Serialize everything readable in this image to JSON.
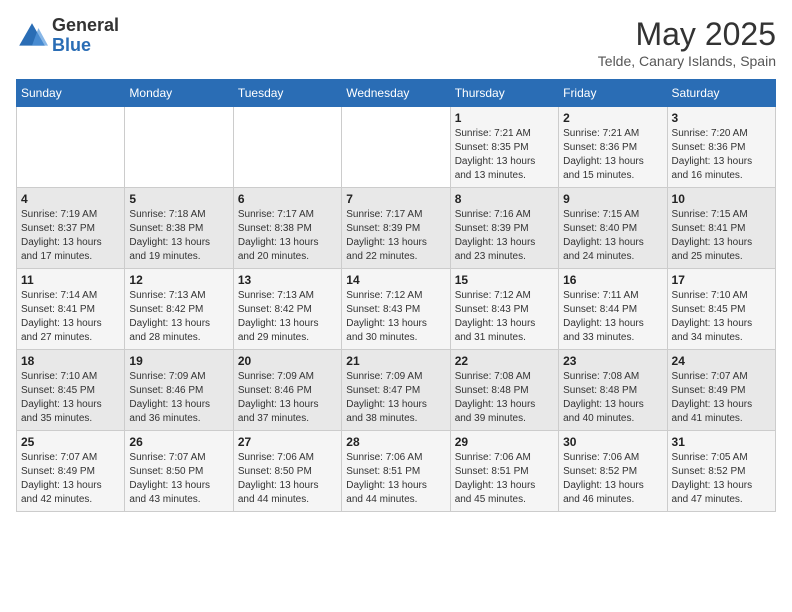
{
  "header": {
    "logo_general": "General",
    "logo_blue": "Blue",
    "month_year": "May 2025",
    "location": "Telde, Canary Islands, Spain"
  },
  "days_of_week": [
    "Sunday",
    "Monday",
    "Tuesday",
    "Wednesday",
    "Thursday",
    "Friday",
    "Saturday"
  ],
  "weeks": [
    [
      {
        "day": "",
        "content": ""
      },
      {
        "day": "",
        "content": ""
      },
      {
        "day": "",
        "content": ""
      },
      {
        "day": "",
        "content": ""
      },
      {
        "day": "1",
        "content": "Sunrise: 7:21 AM\nSunset: 8:35 PM\nDaylight: 13 hours\nand 13 minutes."
      },
      {
        "day": "2",
        "content": "Sunrise: 7:21 AM\nSunset: 8:36 PM\nDaylight: 13 hours\nand 15 minutes."
      },
      {
        "day": "3",
        "content": "Sunrise: 7:20 AM\nSunset: 8:36 PM\nDaylight: 13 hours\nand 16 minutes."
      }
    ],
    [
      {
        "day": "4",
        "content": "Sunrise: 7:19 AM\nSunset: 8:37 PM\nDaylight: 13 hours\nand 17 minutes."
      },
      {
        "day": "5",
        "content": "Sunrise: 7:18 AM\nSunset: 8:38 PM\nDaylight: 13 hours\nand 19 minutes."
      },
      {
        "day": "6",
        "content": "Sunrise: 7:17 AM\nSunset: 8:38 PM\nDaylight: 13 hours\nand 20 minutes."
      },
      {
        "day": "7",
        "content": "Sunrise: 7:17 AM\nSunset: 8:39 PM\nDaylight: 13 hours\nand 22 minutes."
      },
      {
        "day": "8",
        "content": "Sunrise: 7:16 AM\nSunset: 8:39 PM\nDaylight: 13 hours\nand 23 minutes."
      },
      {
        "day": "9",
        "content": "Sunrise: 7:15 AM\nSunset: 8:40 PM\nDaylight: 13 hours\nand 24 minutes."
      },
      {
        "day": "10",
        "content": "Sunrise: 7:15 AM\nSunset: 8:41 PM\nDaylight: 13 hours\nand 25 minutes."
      }
    ],
    [
      {
        "day": "11",
        "content": "Sunrise: 7:14 AM\nSunset: 8:41 PM\nDaylight: 13 hours\nand 27 minutes."
      },
      {
        "day": "12",
        "content": "Sunrise: 7:13 AM\nSunset: 8:42 PM\nDaylight: 13 hours\nand 28 minutes."
      },
      {
        "day": "13",
        "content": "Sunrise: 7:13 AM\nSunset: 8:42 PM\nDaylight: 13 hours\nand 29 minutes."
      },
      {
        "day": "14",
        "content": "Sunrise: 7:12 AM\nSunset: 8:43 PM\nDaylight: 13 hours\nand 30 minutes."
      },
      {
        "day": "15",
        "content": "Sunrise: 7:12 AM\nSunset: 8:43 PM\nDaylight: 13 hours\nand 31 minutes."
      },
      {
        "day": "16",
        "content": "Sunrise: 7:11 AM\nSunset: 8:44 PM\nDaylight: 13 hours\nand 33 minutes."
      },
      {
        "day": "17",
        "content": "Sunrise: 7:10 AM\nSunset: 8:45 PM\nDaylight: 13 hours\nand 34 minutes."
      }
    ],
    [
      {
        "day": "18",
        "content": "Sunrise: 7:10 AM\nSunset: 8:45 PM\nDaylight: 13 hours\nand 35 minutes."
      },
      {
        "day": "19",
        "content": "Sunrise: 7:09 AM\nSunset: 8:46 PM\nDaylight: 13 hours\nand 36 minutes."
      },
      {
        "day": "20",
        "content": "Sunrise: 7:09 AM\nSunset: 8:46 PM\nDaylight: 13 hours\nand 37 minutes."
      },
      {
        "day": "21",
        "content": "Sunrise: 7:09 AM\nSunset: 8:47 PM\nDaylight: 13 hours\nand 38 minutes."
      },
      {
        "day": "22",
        "content": "Sunrise: 7:08 AM\nSunset: 8:48 PM\nDaylight: 13 hours\nand 39 minutes."
      },
      {
        "day": "23",
        "content": "Sunrise: 7:08 AM\nSunset: 8:48 PM\nDaylight: 13 hours\nand 40 minutes."
      },
      {
        "day": "24",
        "content": "Sunrise: 7:07 AM\nSunset: 8:49 PM\nDaylight: 13 hours\nand 41 minutes."
      }
    ],
    [
      {
        "day": "25",
        "content": "Sunrise: 7:07 AM\nSunset: 8:49 PM\nDaylight: 13 hours\nand 42 minutes."
      },
      {
        "day": "26",
        "content": "Sunrise: 7:07 AM\nSunset: 8:50 PM\nDaylight: 13 hours\nand 43 minutes."
      },
      {
        "day": "27",
        "content": "Sunrise: 7:06 AM\nSunset: 8:50 PM\nDaylight: 13 hours\nand 44 minutes."
      },
      {
        "day": "28",
        "content": "Sunrise: 7:06 AM\nSunset: 8:51 PM\nDaylight: 13 hours\nand 44 minutes."
      },
      {
        "day": "29",
        "content": "Sunrise: 7:06 AM\nSunset: 8:51 PM\nDaylight: 13 hours\nand 45 minutes."
      },
      {
        "day": "30",
        "content": "Sunrise: 7:06 AM\nSunset: 8:52 PM\nDaylight: 13 hours\nand 46 minutes."
      },
      {
        "day": "31",
        "content": "Sunrise: 7:05 AM\nSunset: 8:52 PM\nDaylight: 13 hours\nand 47 minutes."
      }
    ]
  ]
}
